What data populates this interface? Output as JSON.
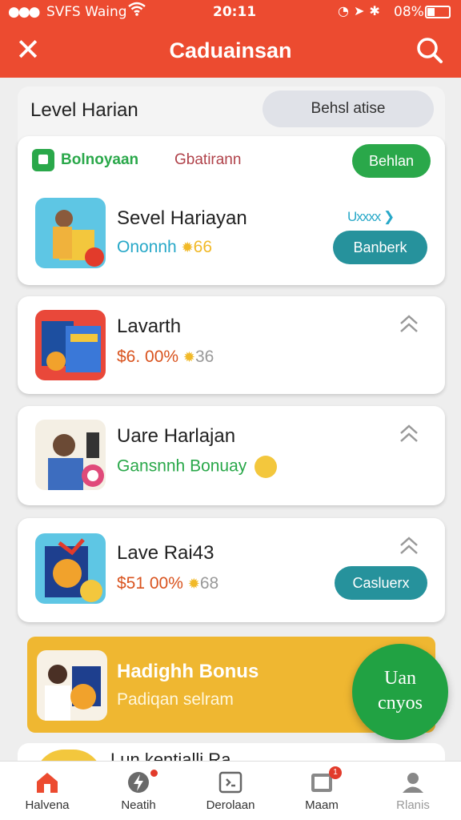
{
  "status_bar": {
    "signal": "●●●",
    "carrier": "SVFS Waing",
    "time": "20:11",
    "battery": "08%"
  },
  "app_bar": {
    "title": "Caduainsan",
    "close_icon": "close-icon",
    "search_icon": "search-icon"
  },
  "header": {
    "title": "Level Harian",
    "pill": "Behsl atise"
  },
  "card1": {
    "brand": "Bolnoyaan",
    "brand2": "Gbatirann",
    "tag_button": "Behlan",
    "item": {
      "name": "Sevel Hariayan",
      "sub": "Ononnh",
      "sub_value": "66",
      "stars": "Uxxxx",
      "button": "Banberk"
    }
  },
  "items": [
    {
      "name": "Lavarth",
      "price": "$6. 00%",
      "value": "36"
    },
    {
      "name": "Uare Harlajan",
      "sub": "Gansnnh Bonuay"
    },
    {
      "name": "Lave Rai43",
      "price": "$51 00%",
      "value": "68",
      "button": "Casluerx"
    }
  ],
  "bonus": {
    "title": "Hadighh Bonus",
    "sub": "Padiqan selram"
  },
  "fab": {
    "line1": "Uan",
    "line2": "cnyos"
  },
  "peek": {
    "title": "Lun kentialli Ra"
  },
  "nav": [
    {
      "label": "Halvena",
      "icon": "home-icon"
    },
    {
      "label": "Neatih",
      "icon": "bolt-icon"
    },
    {
      "label": "Derolaan",
      "icon": "grid-icon"
    },
    {
      "label": "Maam",
      "icon": "inbox-icon",
      "badge": "1"
    },
    {
      "label": "Rlanis",
      "icon": "profile-icon"
    }
  ],
  "colors": {
    "primary": "#ec4b30",
    "green": "#2aa84a",
    "teal": "#26929c",
    "orange": "#d9531e",
    "yellow": "#efb731"
  }
}
